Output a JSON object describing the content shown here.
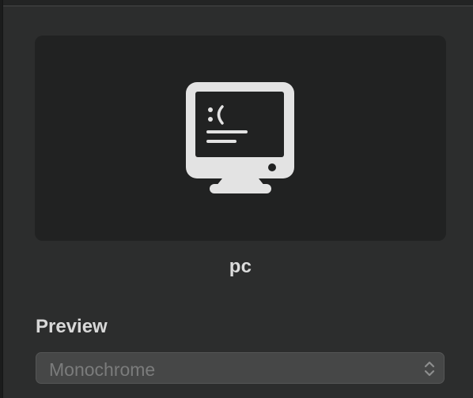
{
  "device": {
    "name": "pc",
    "icon": "monitor-sad-face-icon"
  },
  "preview": {
    "label": "Preview",
    "selected": "Monochrome",
    "indicator_icon": "chevron-up-down-icon"
  },
  "colors": {
    "panel_bg": "#2c2d2d",
    "preview_bg": "#212222",
    "icon": "#e3e3e3",
    "select_bg": "#464747"
  }
}
